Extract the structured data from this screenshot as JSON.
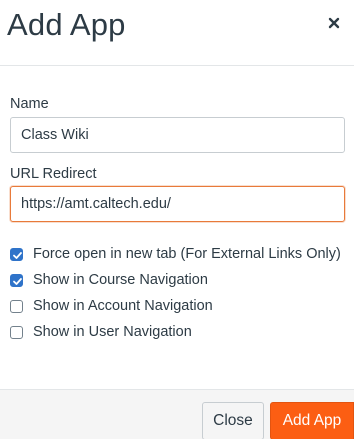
{
  "dialog": {
    "title": "Add App",
    "close_icon": "close-x-icon"
  },
  "form": {
    "name": {
      "label": "Name",
      "value": "Class Wiki"
    },
    "url_redirect": {
      "label": "URL Redirect",
      "value": "https://amt.caltech.edu/"
    },
    "options": [
      {
        "label": "Force open in new tab (For External Links Only)",
        "checked": true
      },
      {
        "label": "Show in Course Navigation",
        "checked": true
      },
      {
        "label": "Show in Account Navigation",
        "checked": false
      },
      {
        "label": "Show in User Navigation",
        "checked": false
      }
    ]
  },
  "footer": {
    "close_label": "Close",
    "add_label": "Add App"
  },
  "colors": {
    "primary_button": "#fc5e13",
    "checkbox_checked": "#2f73c9",
    "focus_border": "#e87a3a"
  }
}
